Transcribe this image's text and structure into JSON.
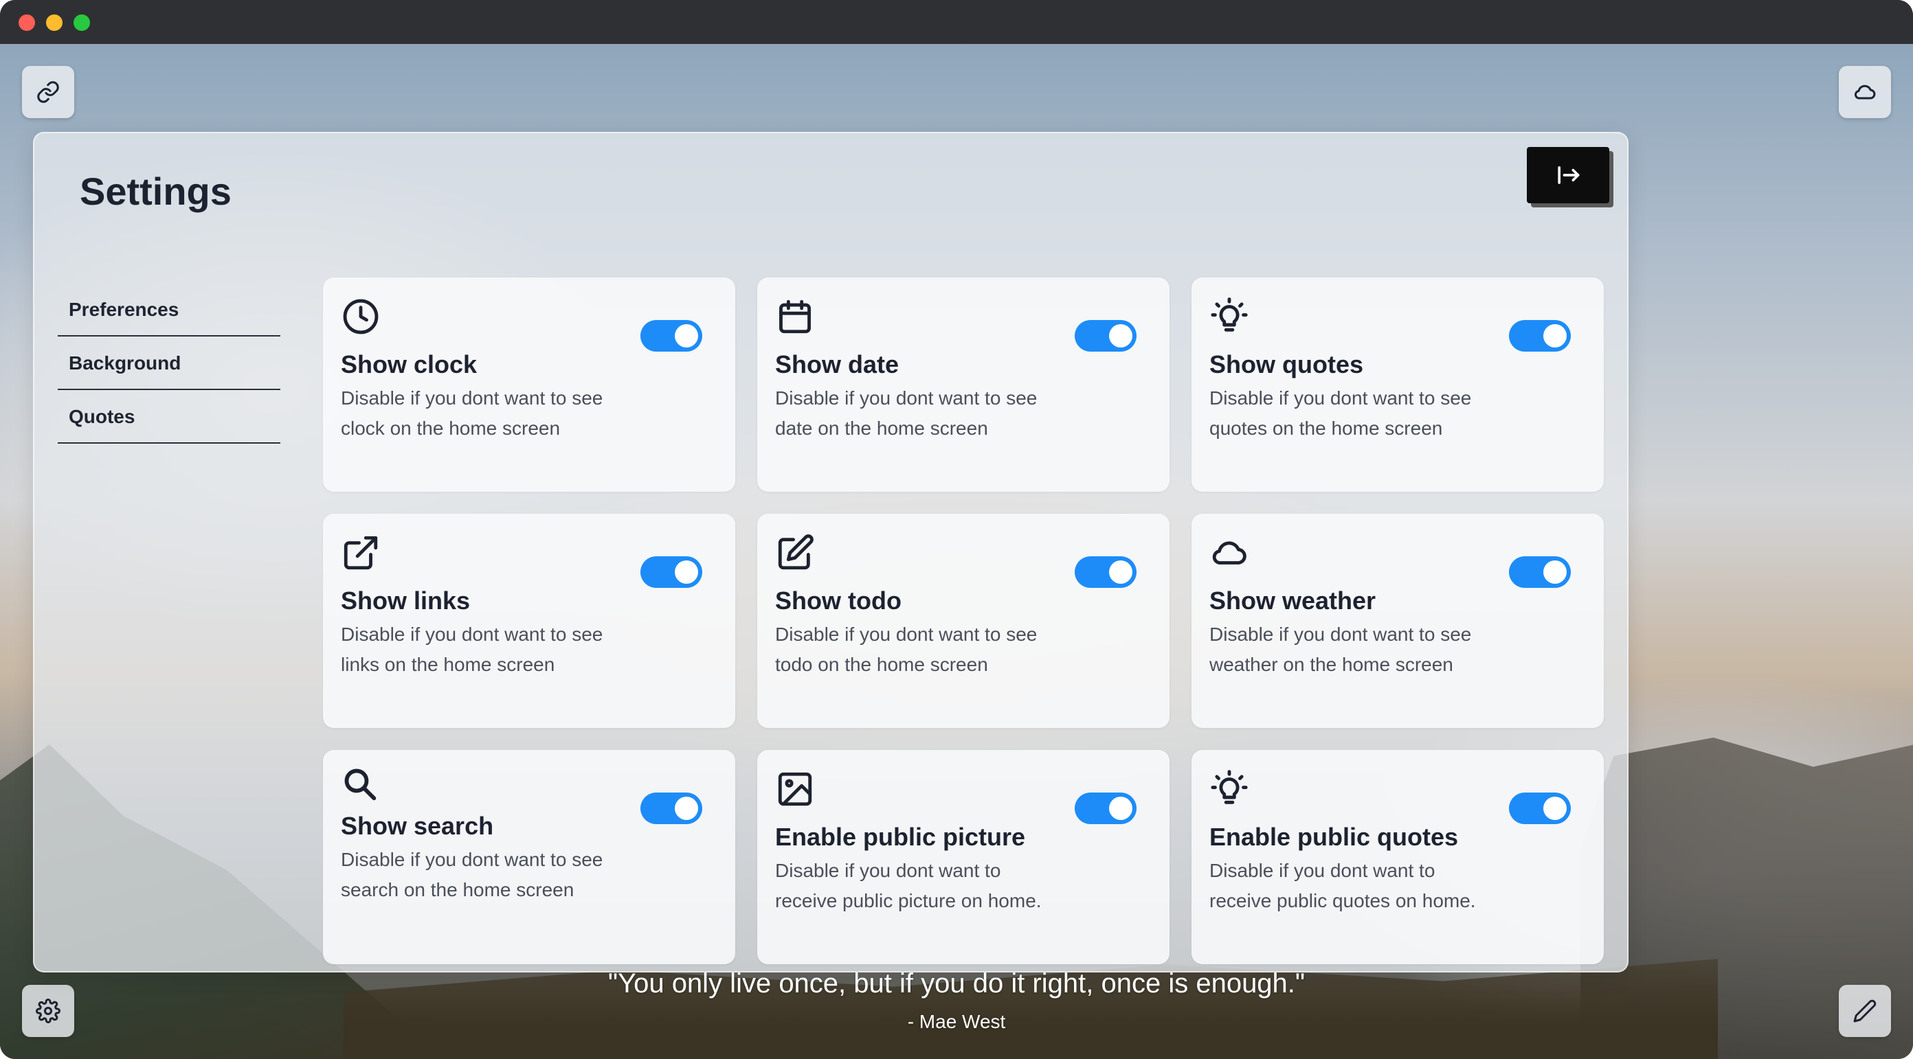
{
  "panel": {
    "title": "Settings",
    "close_icon": "exit-right-icon"
  },
  "nav": {
    "items": [
      {
        "label": "Preferences"
      },
      {
        "label": "Background"
      },
      {
        "label": "Quotes"
      }
    ]
  },
  "cards": [
    {
      "icon": "clock-icon",
      "title": "Show clock",
      "desc": "Disable if you dont want to see clock on the home screen",
      "enabled": true
    },
    {
      "icon": "calendar-icon",
      "title": "Show date",
      "desc": "Disable if you dont want to see date on the home screen",
      "enabled": true
    },
    {
      "icon": "lightbulb-icon",
      "title": "Show quotes",
      "desc": "Disable if you dont want to see quotes on the home screen",
      "enabled": true
    },
    {
      "icon": "external-link-icon",
      "title": "Show links",
      "desc": "Disable if you dont want to see links on the home screen",
      "enabled": true
    },
    {
      "icon": "edit-icon",
      "title": "Show todo",
      "desc": "Disable if you dont want to see todo on the home screen",
      "enabled": true
    },
    {
      "icon": "cloud-icon",
      "title": "Show weather",
      "desc": "Disable if you dont want to see weather on the home screen",
      "enabled": true
    },
    {
      "icon": "search-icon",
      "title": "Show search",
      "desc": "Disable if you dont want to see search on the home screen",
      "enabled": true
    },
    {
      "icon": "image-icon",
      "title": "Enable public picture",
      "desc": "Disable if you dont want to receive public picture on home.",
      "enabled": true
    },
    {
      "icon": "lightbulb-icon",
      "title": "Enable public quotes",
      "desc": "Disable if you dont want to receive public quotes on home.",
      "enabled": true
    }
  ],
  "quote": {
    "text": "\"You only live once, but if you do it right, once is enough.\"",
    "author": "- Mae West"
  },
  "colors": {
    "toggle_on": "#1d8cf8",
    "title": "#1c2230"
  }
}
